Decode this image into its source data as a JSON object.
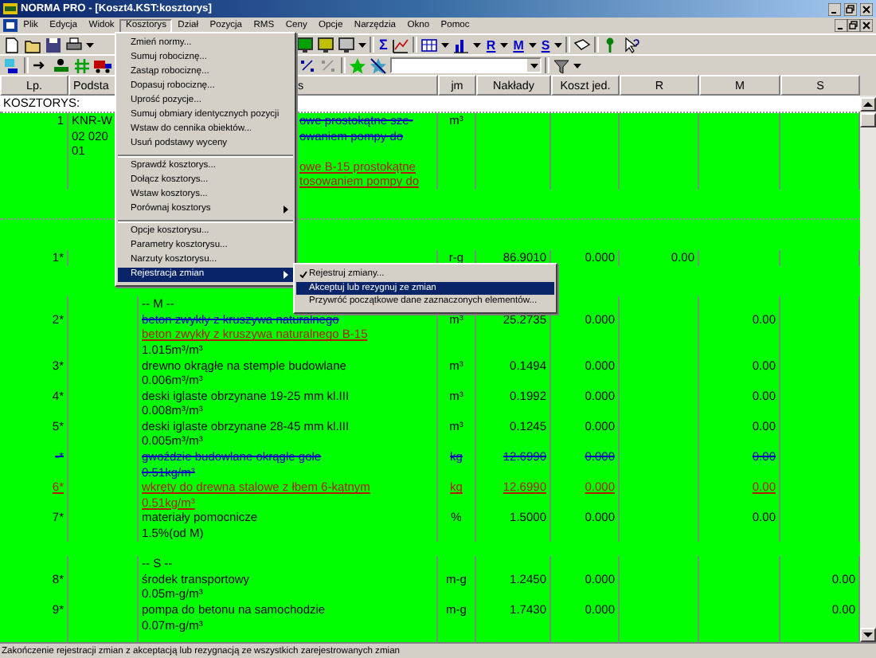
{
  "window": {
    "title": "NORMA PRO - [Koszt4.KST:kosztorys]"
  },
  "menu_bar": [
    {
      "label": "Plik",
      "selected": false
    },
    {
      "label": "Edycja",
      "selected": false
    },
    {
      "label": "Widok",
      "selected": false
    },
    {
      "label": "Kosztorys",
      "selected": true
    },
    {
      "label": "Dział",
      "selected": false
    },
    {
      "label": "Pozycja",
      "selected": false
    },
    {
      "label": "RMS",
      "selected": false
    },
    {
      "label": "Ceny",
      "selected": false
    },
    {
      "label": "Opcje",
      "selected": false
    },
    {
      "label": "Narzędzia",
      "selected": false
    },
    {
      "label": "Okno",
      "selected": false
    },
    {
      "label": "Pomoc",
      "selected": false
    }
  ],
  "toolbar": {
    "sum_label": "Σ",
    "resource_buttons": [
      "R",
      "M",
      "S"
    ]
  },
  "columns": [
    "Lp.",
    "Podsta",
    "s",
    "jm",
    "Nakłady",
    "Koszt jed.",
    "R",
    "M",
    "S"
  ],
  "estimate_label": "KOSZTORYS:",
  "rows": [
    {
      "kind": "position",
      "deleted": false,
      "inserted": false,
      "lp": "1",
      "basis": [
        "KNR-W",
        "02 020",
        "01"
      ],
      "desc": [
        {
          "text": "owe prostokątne sze-",
          "deleted": true,
          "inserted": false
        },
        {
          "text": "owaniem pompy do",
          "deleted": true,
          "inserted": false
        },
        {
          "text": "owe B-15 prostokątne",
          "deleted": false,
          "inserted": true
        },
        {
          "text": "tosowaniem pompy do",
          "deleted": false,
          "inserted": true
        }
      ],
      "jm": "m³"
    },
    {
      "kind": "labor",
      "deleted": false,
      "inserted": false,
      "lp": "1*",
      "jm": "r-g",
      "quantity": "86.9010",
      "unit_cost": "0.000",
      "r": "0.00"
    },
    {
      "kind": "section",
      "label": "-- M --"
    },
    {
      "kind": "resource",
      "deleted": false,
      "inserted": false,
      "lp": "2*",
      "desc": [
        {
          "text": "beton zwykły z kruszywa naturalnego",
          "deleted": true,
          "inserted": false
        },
        {
          "text": "beton zwykły z kruszywa naturalnego B-15",
          "deleted": false,
          "inserted": true
        },
        {
          "text": "1.015m³/m³",
          "deleted": false,
          "inserted": false
        }
      ],
      "jm": "m³",
      "quantity": "25.2735",
      "unit_cost": "0.000",
      "m": "0.00"
    },
    {
      "kind": "resource",
      "deleted": false,
      "inserted": false,
      "lp": "3*",
      "desc": [
        {
          "text": "drewno okrągłe na stemple budowlane",
          "deleted": false,
          "inserted": false
        },
        {
          "text": "0.006m³/m³",
          "deleted": false,
          "inserted": false
        }
      ],
      "jm": "m³",
      "quantity": "0.1494",
      "unit_cost": "0.000",
      "m": "0.00"
    },
    {
      "kind": "resource",
      "deleted": false,
      "inserted": false,
      "lp": "4*",
      "desc": [
        {
          "text": "deski iglaste obrzynane 19-25 mm kl.III",
          "deleted": false,
          "inserted": false
        },
        {
          "text": "0.008m³/m³",
          "deleted": false,
          "inserted": false
        }
      ],
      "jm": "m³",
      "quantity": "0.1992",
      "unit_cost": "0.000",
      "m": "0.00"
    },
    {
      "kind": "resource",
      "deleted": false,
      "inserted": false,
      "lp": "5*",
      "desc": [
        {
          "text": "deski iglaste obrzynane 28-45 mm kl.III",
          "deleted": false,
          "inserted": false
        },
        {
          "text": "0.005m³/m³",
          "deleted": false,
          "inserted": false
        }
      ],
      "jm": "m³",
      "quantity": "0.1245",
      "unit_cost": "0.000",
      "m": "0.00"
    },
    {
      "kind": "resource",
      "deleted": true,
      "inserted": false,
      "lp": "-*",
      "desc": [
        {
          "text": "gwoździe budowlane okrągłe gołe",
          "deleted": true,
          "inserted": false
        },
        {
          "text": "0.51kg/m³",
          "deleted": true,
          "inserted": false
        }
      ],
      "jm": "kg",
      "quantity": "12.6990",
      "unit_cost": "0.000",
      "m": "0.00"
    },
    {
      "kind": "resource",
      "deleted": false,
      "inserted": true,
      "lp": "6*",
      "desc": [
        {
          "text": "wkręty do drewna stalowe z łbem 6-kątnym",
          "deleted": false,
          "inserted": true
        },
        {
          "text": "0.51kg/m³",
          "deleted": false,
          "inserted": true
        }
      ],
      "jm": "kg",
      "quantity": "12.6990",
      "unit_cost": "0.000",
      "m": "0.00"
    },
    {
      "kind": "resource",
      "deleted": false,
      "inserted": false,
      "lp": "7*",
      "desc": [
        {
          "text": "materiały pomocnicze",
          "deleted": false,
          "inserted": false
        },
        {
          "text": "1.5%(od M)",
          "deleted": false,
          "inserted": false
        }
      ],
      "jm": "%",
      "quantity": "1.5000",
      "unit_cost": "0.000",
      "m": "0.00"
    },
    {
      "kind": "section",
      "label": "-- S --"
    },
    {
      "kind": "resource",
      "deleted": false,
      "inserted": false,
      "lp": "8*",
      "desc": [
        {
          "text": "środek transportowy",
          "deleted": false,
          "inserted": false
        },
        {
          "text": "0.05m-g/m³",
          "deleted": false,
          "inserted": false
        }
      ],
      "jm": "m-g",
      "quantity": "1.2450",
      "unit_cost": "0.000",
      "s": "0.00"
    },
    {
      "kind": "resource",
      "deleted": false,
      "inserted": false,
      "lp": "9*",
      "desc": [
        {
          "text": "pompa do betonu na samochodzie",
          "deleted": false,
          "inserted": false
        },
        {
          "text": "0.07m-g/m³",
          "deleted": false,
          "inserted": false
        }
      ],
      "jm": "m-g",
      "quantity": "1.7430",
      "unit_cost": "0.000",
      "s": "0.00"
    }
  ],
  "menu": {
    "items": [
      {
        "kind": "item",
        "label": "Zmień normy...",
        "selected": false,
        "submenu": false
      },
      {
        "kind": "item",
        "label": "Sumuj robociznę...",
        "selected": false,
        "submenu": false
      },
      {
        "kind": "item",
        "label": "Zastąp robociznę...",
        "selected": false,
        "submenu": false
      },
      {
        "kind": "item",
        "label": "Dopasuj robociznę...",
        "selected": false,
        "submenu": false
      },
      {
        "kind": "item",
        "label": "Uprość pozycje...",
        "selected": false,
        "submenu": false
      },
      {
        "kind": "item",
        "label": "Sumuj obmiary identycznych pozycji",
        "selected": false,
        "submenu": false
      },
      {
        "kind": "item",
        "label": "Wstaw do cennika obiektów...",
        "selected": false,
        "submenu": false
      },
      {
        "kind": "item",
        "label": "Usuń podstawy wyceny",
        "selected": false,
        "submenu": false
      },
      {
        "kind": "separator"
      },
      {
        "kind": "item",
        "label": "Sprawdź kosztorys...",
        "selected": false,
        "submenu": false
      },
      {
        "kind": "item",
        "label": "Dołącz kosztorys...",
        "selected": false,
        "submenu": false
      },
      {
        "kind": "item",
        "label": "Wstaw kosztorys...",
        "selected": false,
        "submenu": false
      },
      {
        "kind": "item",
        "label": "Porównaj kosztorys",
        "selected": false,
        "submenu": true
      },
      {
        "kind": "separator"
      },
      {
        "kind": "item",
        "label": "Opcje kosztorysu...",
        "selected": false,
        "submenu": false
      },
      {
        "kind": "item",
        "label": "Parametry kosztorysu...",
        "selected": false,
        "submenu": false
      },
      {
        "kind": "item",
        "label": "Narzuty kosztorysu...",
        "selected": false,
        "submenu": false
      },
      {
        "kind": "item",
        "label": "Rejestracja zmian",
        "selected": true,
        "submenu": true
      }
    ]
  },
  "submenu": {
    "items": [
      {
        "label": "Rejestruj zmiany...",
        "checked": true,
        "selected": false
      },
      {
        "label": "Akceptuj lub rezygnuj ze zmian",
        "checked": false,
        "selected": true
      },
      {
        "label": "Przywróć początkowe dane zaznaczonych elementów...",
        "checked": false,
        "selected": false
      }
    ]
  },
  "status_bar": "Zakończenie rejestracji zmian z akceptacją lub rezygnacją ze wszystkich zarejestrowanych zmian"
}
